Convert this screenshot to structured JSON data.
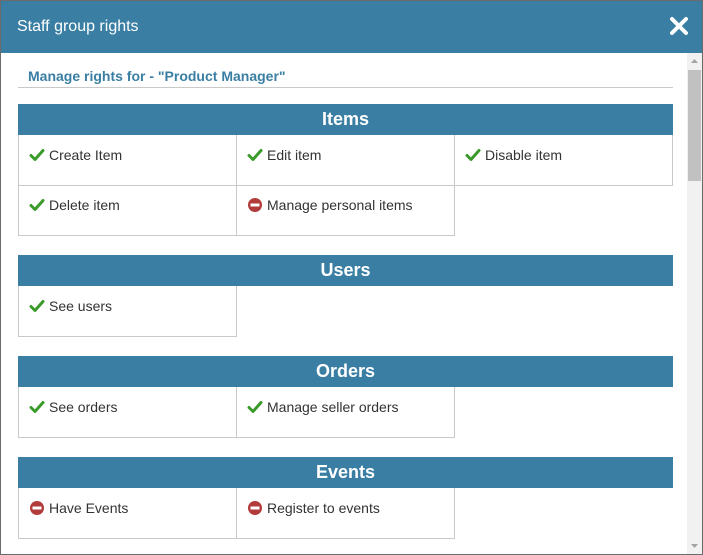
{
  "dialog": {
    "title": "Staff group rights",
    "heading": "Manage rights for - \"Product Manager\""
  },
  "colors": {
    "accent": "#3a7fa3",
    "allowed": "#3a9a2a",
    "denied": "#b23b3b"
  },
  "sections": {
    "items": {
      "title": "Items",
      "rights": [
        {
          "label": "Create Item",
          "status": "allowed"
        },
        {
          "label": "Edit item",
          "status": "allowed"
        },
        {
          "label": "Disable item",
          "status": "allowed"
        },
        {
          "label": "Delete item",
          "status": "allowed"
        },
        {
          "label": "Manage personal items",
          "status": "denied"
        }
      ]
    },
    "users": {
      "title": "Users",
      "rights": [
        {
          "label": "See users",
          "status": "allowed"
        }
      ]
    },
    "orders": {
      "title": "Orders",
      "rights": [
        {
          "label": "See orders",
          "status": "allowed"
        },
        {
          "label": "Manage seller orders",
          "status": "allowed"
        }
      ]
    },
    "events": {
      "title": "Events",
      "rights": [
        {
          "label": "Have Events",
          "status": "denied"
        },
        {
          "label": "Register to events",
          "status": "denied"
        }
      ]
    }
  }
}
